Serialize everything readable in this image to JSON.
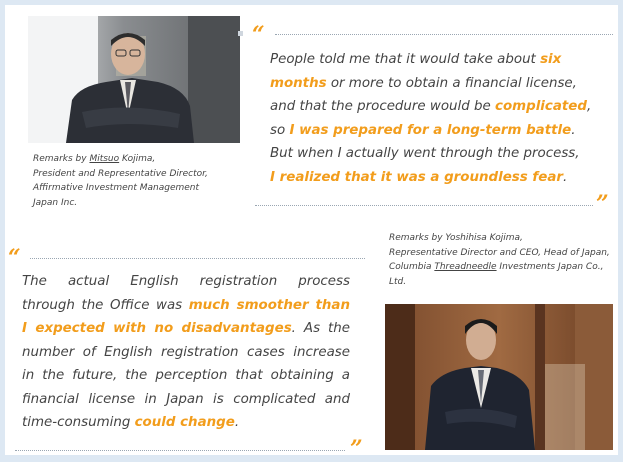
{
  "top": {
    "caption_lines": [
      [
        "Remarks by ",
        "Mitsuo",
        " Kojima,"
      ],
      [
        "President and Representative Director,"
      ],
      [
        "Affirmative Investment Management"
      ],
      [
        "Japan Inc."
      ]
    ],
    "quote_lines": [
      [
        [
          "People told me that it would take about ",
          false
        ],
        [
          "six",
          true
        ]
      ],
      [
        [
          "months",
          true
        ],
        [
          " or more to obtain a financial license,",
          false
        ]
      ],
      [
        [
          "and that the procedure would be ",
          false
        ],
        [
          "complicated",
          true
        ],
        [
          ",",
          false
        ]
      ],
      [
        [
          "so ",
          false
        ],
        [
          "I was prepared for a long-term battle",
          true
        ],
        [
          ".",
          false
        ]
      ],
      [
        [
          "But when I actually went through the process,",
          false
        ]
      ],
      [
        [
          "I realized that it was a groundless fear",
          true
        ],
        [
          ".",
          false
        ]
      ]
    ]
  },
  "bottom": {
    "caption_lines": [
      [
        "Remarks by Yoshihisa Kojima,"
      ],
      [
        "Representative Director and CEO, Head of Japan,"
      ],
      [
        "Columbia ",
        "Threadneedle",
        " Investments Japan Co.,"
      ],
      [
        "Ltd."
      ]
    ],
    "quote_lines": [
      [
        [
          "The actual English registration process",
          false
        ]
      ],
      [
        [
          "through the Office was ",
          false
        ],
        [
          "much smoother than",
          true
        ]
      ],
      [
        [
          "I expected with no disadvantages",
          true
        ],
        [
          ". As the",
          false
        ]
      ],
      [
        [
          "number of English registration cases increase",
          false
        ]
      ],
      [
        [
          "in the future, the perception that obtaining a",
          false
        ]
      ],
      [
        [
          "financial license in Japan is complicated and",
          false
        ]
      ],
      [
        [
          "time-consuming ",
          false
        ],
        [
          "could change",
          true
        ],
        [
          ".",
          false
        ]
      ]
    ]
  },
  "marks": {
    "open": "“",
    "close": "”"
  },
  "colors": {
    "accent": "#f29d1c",
    "background": "#dde8f3",
    "text": "#444444"
  }
}
